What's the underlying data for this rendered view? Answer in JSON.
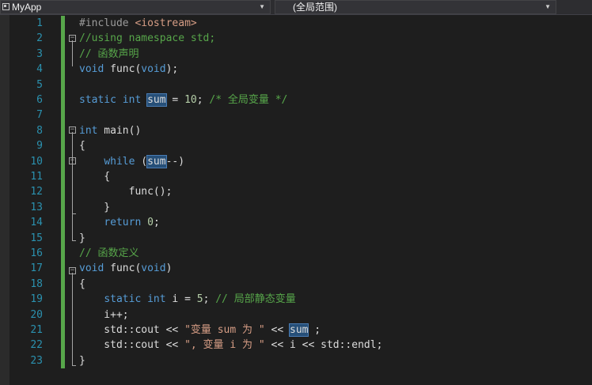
{
  "toolbar": {
    "project_dropdown": "MyApp",
    "scope_dropdown": "(全局范围)"
  },
  "editor": {
    "lines": [
      {
        "n": "1",
        "code": "#include <iostream>"
      },
      {
        "n": "2",
        "code": "//using namespace std;"
      },
      {
        "n": "3",
        "code": "// 函数声明"
      },
      {
        "n": "4",
        "code": "void func(void);"
      },
      {
        "n": "5",
        "code": ""
      },
      {
        "n": "6",
        "code": "static int sum = 10; /* 全局变量 */"
      },
      {
        "n": "7",
        "code": ""
      },
      {
        "n": "8",
        "code": "int main()"
      },
      {
        "n": "9",
        "code": "{"
      },
      {
        "n": "10",
        "code": "    while (sum--)"
      },
      {
        "n": "11",
        "code": "    {"
      },
      {
        "n": "12",
        "code": "        func();"
      },
      {
        "n": "13",
        "code": "    }"
      },
      {
        "n": "14",
        "code": "    return 0;"
      },
      {
        "n": "15",
        "code": "}"
      },
      {
        "n": "16",
        "code": "// 函数定义"
      },
      {
        "n": "17",
        "code": "void func(void)"
      },
      {
        "n": "18",
        "code": "{"
      },
      {
        "n": "19",
        "code": "    static int i = 5; // 局部静态变量"
      },
      {
        "n": "20",
        "code": "    i++;"
      },
      {
        "n": "21",
        "code": "    std::cout << \"变量 sum 为 \" << sum ;"
      },
      {
        "n": "22",
        "code": "    std::cout << \", 变量 i 为 \" << i << std::endl;"
      },
      {
        "n": "23",
        "code": "}"
      }
    ]
  },
  "colors": {
    "background": "#1e1e1e",
    "keyword": "#569cd6",
    "comment": "#57a64a",
    "string": "#d69d85",
    "line_number": "#2b91af",
    "change_marker": "#57a64a",
    "highlight": "#264f78"
  },
  "icons": {
    "project": "project-icon",
    "dropdown": "chevron-down-icon",
    "fold": "collapse-icon"
  }
}
